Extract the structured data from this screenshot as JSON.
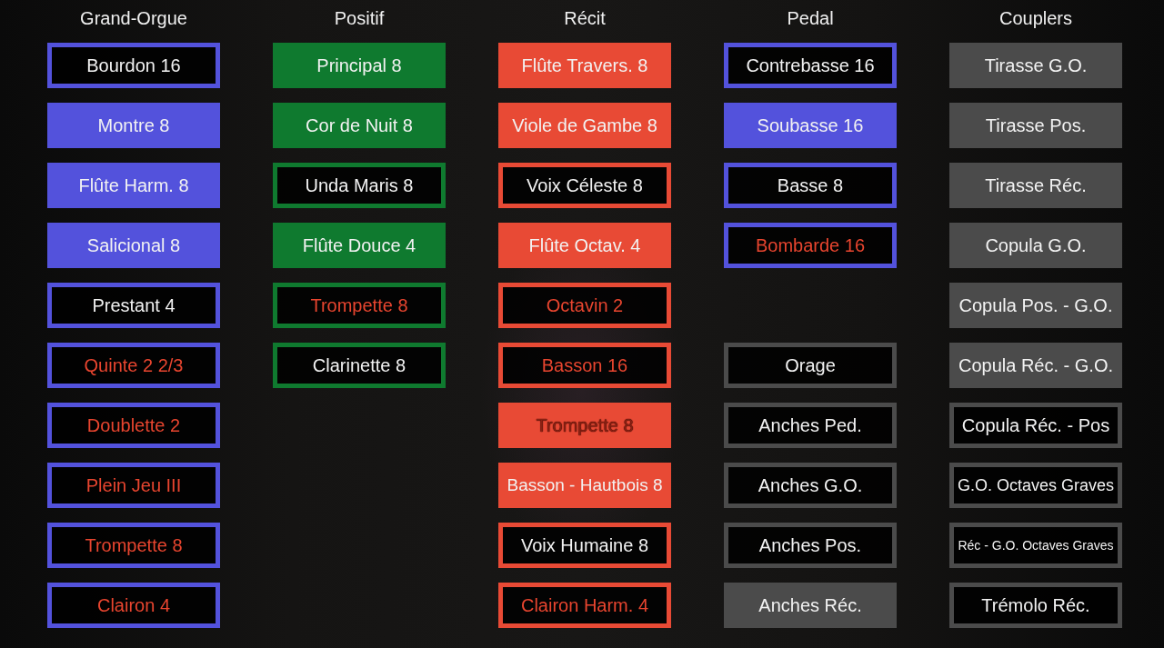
{
  "divisions": [
    {
      "name": "Grand-Orgue",
      "groups": [
        {
          "color": "#5352dc",
          "stops": [
            {
              "label": "Bourdon 16",
              "on": false,
              "accented": false
            },
            {
              "label": "Montre 8",
              "on": true,
              "accented": false
            },
            {
              "label": "Flûte Harm. 8",
              "on": true,
              "accented": false
            },
            {
              "label": "Salicional 8",
              "on": true,
              "accented": false
            },
            {
              "label": "Prestant 4",
              "on": false,
              "accented": false
            },
            {
              "label": "Quinte 2 2/3",
              "on": false,
              "accented": true
            },
            {
              "label": "Doublette 2",
              "on": false,
              "accented": true
            },
            {
              "label": "Plein Jeu III",
              "on": false,
              "accented": true
            },
            {
              "label": "Trompette 8",
              "on": false,
              "accented": true
            },
            {
              "label": "Clairon 4",
              "on": false,
              "accented": true
            }
          ]
        }
      ]
    },
    {
      "name": "Positif",
      "groups": [
        {
          "color": "#0f7a2f",
          "stops": [
            {
              "label": "Principal 8",
              "on": true,
              "accented": false
            },
            {
              "label": "Cor de Nuit 8",
              "on": true,
              "accented": false
            },
            {
              "label": "Unda Maris 8",
              "on": false,
              "accented": false
            },
            {
              "label": "Flûte Douce 4",
              "on": true,
              "accented": false
            },
            {
              "label": "Trompette 8",
              "on": false,
              "accented": true
            },
            {
              "label": "Clarinette 8",
              "on": false,
              "accented": false
            }
          ]
        }
      ]
    },
    {
      "name": "Récit",
      "groups": [
        {
          "color": "#e84a35",
          "stops": [
            {
              "label": "Flûte Travers. 8",
              "on": true,
              "accented": false
            },
            {
              "label": "Viole de Gambe 8",
              "on": true,
              "accented": false
            },
            {
              "label": "Voix Céleste 8",
              "on": false,
              "accented": false
            },
            {
              "label": "Flûte Octav. 4",
              "on": true,
              "accented": false
            },
            {
              "label": "Octavin 2",
              "on": false,
              "accented": true
            },
            {
              "label": "Basson 16",
              "on": false,
              "accented": true
            },
            {
              "label": "Trompette 8",
              "on": true,
              "accented": true
            },
            {
              "label": "Basson - Hautbois 8",
              "on": true,
              "accented": false
            },
            {
              "label": "Voix Humaine 8",
              "on": false,
              "accented": false
            },
            {
              "label": "Clairon Harm. 4",
              "on": false,
              "accented": true
            }
          ]
        }
      ]
    },
    {
      "name": "Pedal",
      "groups": [
        {
          "color": "#5352dc",
          "stops": [
            {
              "label": "Contrebasse 16",
              "on": false,
              "accented": false
            },
            {
              "label": "Soubasse 16",
              "on": true,
              "accented": false
            },
            {
              "label": "Basse 8",
              "on": false,
              "accented": false
            },
            {
              "label": "Bombarde 16",
              "on": false,
              "accented": true
            }
          ]
        },
        {
          "color": "#4b4b4b",
          "stops": [
            {
              "label": "Orage",
              "on": false,
              "accented": false
            },
            {
              "label": "Anches Ped.",
              "on": false,
              "accented": false
            },
            {
              "label": "Anches G.O.",
              "on": false,
              "accented": false
            },
            {
              "label": "Anches Pos.",
              "on": false,
              "accented": false
            },
            {
              "label": "Anches Réc.",
              "on": true,
              "accented": false
            }
          ]
        }
      ]
    },
    {
      "name": "Couplers",
      "groups": [
        {
          "color": "#4b4b4b",
          "stops": [
            {
              "label": "Tirasse G.O.",
              "on": true,
              "accented": false
            },
            {
              "label": "Tirasse Pos.",
              "on": true,
              "accented": false
            },
            {
              "label": "Tirasse Réc.",
              "on": true,
              "accented": false
            },
            {
              "label": "Copula G.O.",
              "on": true,
              "accented": false
            },
            {
              "label": "Copula Pos. - G.O.",
              "on": true,
              "accented": false
            },
            {
              "label": "Copula Réc. - G.O.",
              "on": true,
              "accented": false
            },
            {
              "label": "Copula Réc. - Pos",
              "on": false,
              "accented": false
            },
            {
              "label": "G.O. Octaves Graves",
              "on": false,
              "accented": false
            },
            {
              "label": "Réc - G.O. Octaves Graves",
              "on": false,
              "accented": false
            },
            {
              "label": "Trémolo Réc.",
              "on": false,
              "accented": false
            }
          ]
        }
      ]
    }
  ]
}
